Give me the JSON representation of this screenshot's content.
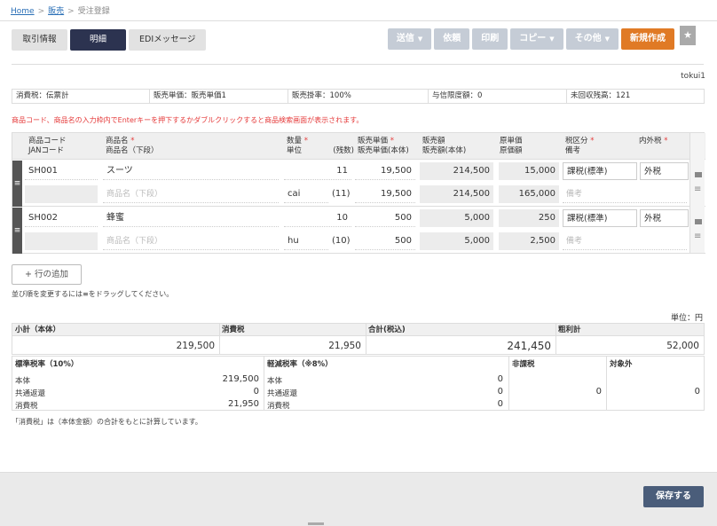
{
  "breadcrumb": {
    "home": "Home",
    "sales": "販売",
    "current": "受注登録"
  },
  "tabs": [
    "取引情報",
    "明細",
    "EDIメッセージ"
  ],
  "actions": {
    "send": "送信",
    "request": "依頼",
    "print": "印刷",
    "copy": "コピー",
    "other": "その他",
    "new": "新規作成"
  },
  "user": "tokui1",
  "info": {
    "tax": "消費税：伝票計",
    "price": "販売単価：販売単価1",
    "rate": "販売掛率：100%",
    "credit": "与信限度額：0",
    "uncollected": "未回収残高：121"
  },
  "notice": "商品コード、商品名の入力枠内でEnterキーを押下するかダブルクリックすると商品検索画面が表示されます。",
  "headers": {
    "code": "商品コード",
    "jan": "JANコード",
    "name": "商品名",
    "name2": "商品名（下段）",
    "qty": "数量",
    "unit": "単位",
    "remain": "(残数)",
    "price": "販売単価",
    "price_base": "販売単価(本体)",
    "amount": "販売額",
    "amount_base": "販売額(本体)",
    "cost": "原単価",
    "cost_total": "原価額",
    "taxcls": "税区分",
    "note": "備考",
    "taxin": "内外税",
    "req": "*"
  },
  "rows": [
    {
      "code": "SH001",
      "name": "スーツ",
      "name2_ph": "商品名（下段）",
      "qty": "11",
      "unit": "cai",
      "remain": "(11)",
      "price": "19,500",
      "price_base": "19,500",
      "amount": "214,500",
      "amount_base": "214,500",
      "cost": "15,000",
      "cost_total": "165,000",
      "taxcls": "課税(標準)",
      "taxin": "外税",
      "note_ph": "備考"
    },
    {
      "code": "SH002",
      "name": "蜂蜜",
      "name2_ph": "商品名（下段）",
      "qty": "10",
      "unit": "hu",
      "remain": "(10)",
      "price": "500",
      "price_base": "500",
      "amount": "5,000",
      "amount_base": "5,000",
      "cost": "250",
      "cost_total": "2,500",
      "taxcls": "課税(標準)",
      "taxin": "外税",
      "note_ph": "備考"
    }
  ],
  "add_row": "+ 行の追加",
  "sort_note": "並び順を変更するには≡をドラッグしてください。",
  "unit_label": "単位：円",
  "totals": {
    "subtotal_label": "小計（本体）",
    "subtotal": "219,500",
    "tax_label": "消費税",
    "tax": "21,950",
    "total_label": "合計(税込)",
    "total": "241,450",
    "gross_label": "粗利計",
    "gross": "52,000"
  },
  "taxbreak": {
    "std_label": "標準税率（10%）",
    "red_label": "軽減税率（※8%）",
    "nontax_label": "非課税",
    "excluded_label": "対象外",
    "body": "本体",
    "return": "共通返還",
    "tax": "消費税",
    "std_body": "219,500",
    "std_return": "0",
    "std_tax": "21,950",
    "red_body": "0",
    "red_return": "0",
    "red_tax": "0",
    "nontax": "0",
    "excluded": "0"
  },
  "calc_note": "「消費税」は（本体金額）の合計をもとに計算しています。",
  "save": "保存する"
}
